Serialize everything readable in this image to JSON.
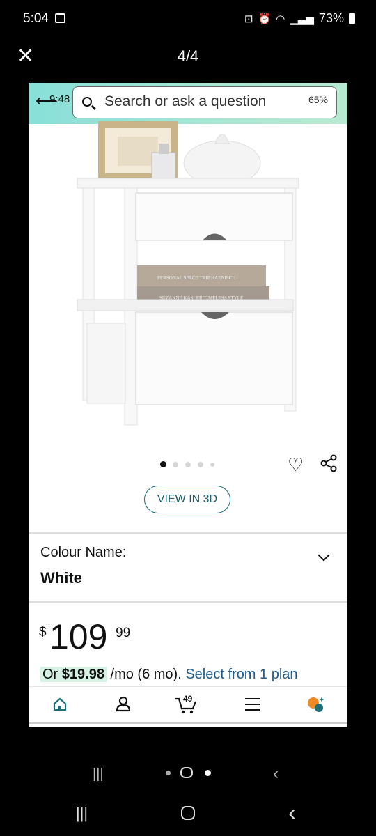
{
  "status_bar": {
    "time": "5:04",
    "battery": "73%"
  },
  "viewer": {
    "counter": "4/4"
  },
  "inner_screen": {
    "time": "9:48",
    "battery": "65%",
    "search_placeholder": "Search or ask a question"
  },
  "product": {
    "image_dots": 5,
    "active_dot": 0,
    "view_3d_label": "VIEW IN 3D",
    "book_title_1": "PERSONAL SPACE TRIP HAENISCH",
    "book_title_2": "SUZANNE KASLER TIMELESS STYLE",
    "colour": {
      "label": "Colour Name:",
      "value": "White"
    },
    "price": {
      "symbol": "$",
      "whole": "109",
      "cents": "99"
    },
    "monthly": {
      "prefix": "Or",
      "amount": "$19.98",
      "term": "/mo (6 mo).",
      "link": "Select from 1 plan"
    }
  },
  "bottom_nav": {
    "cart_count": "49",
    "items": [
      "home-icon",
      "account-icon",
      "cart-icon",
      "menu-icon",
      "rufus-icon"
    ]
  },
  "colors": {
    "header_gradient_start": "#88dfd9",
    "link_blue": "#1f5c8c",
    "view3d_border": "#1f6f7a",
    "active_nav": "#1f6f7a",
    "rufus_orange": "#f08a24"
  }
}
